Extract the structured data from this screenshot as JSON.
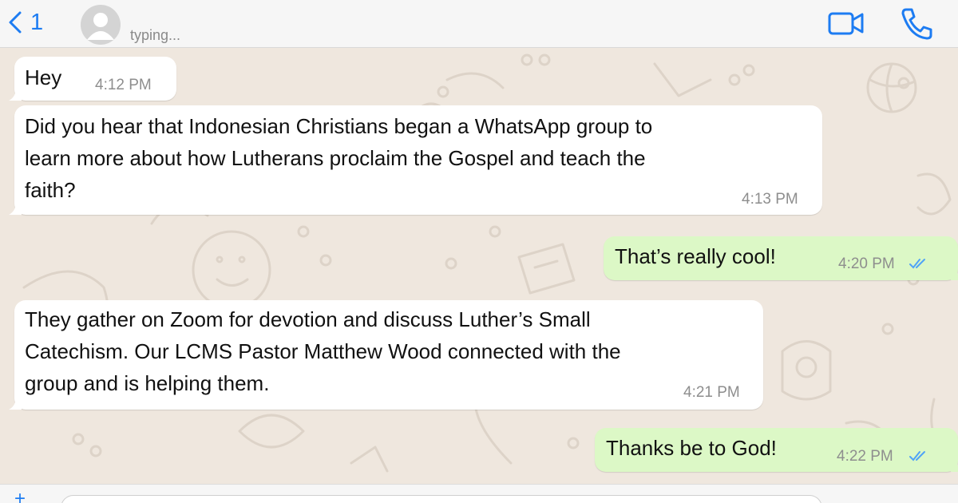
{
  "header": {
    "back_count": "1",
    "status": "typing...",
    "icons": [
      "chevron-left-icon",
      "avatar-placeholder-icon",
      "video-call-icon",
      "phone-call-icon"
    ]
  },
  "colors": {
    "accent": "#1d7cf2",
    "incoming_bubble": "#ffffff",
    "outgoing_bubble": "#dcf8c6",
    "wallpaper": "#efe7de",
    "read_ticks": "#4fa3f7"
  },
  "messages": [
    {
      "direction": "in",
      "lines": [
        "Hey"
      ],
      "time": "4:12 PM"
    },
    {
      "direction": "in",
      "lines": [
        "Did you hear that Indonesian Christians began a WhatsApp group to",
        "learn more about how Lutherans proclaim the Gospel and teach the",
        "faith?"
      ],
      "time": "4:13 PM"
    },
    {
      "direction": "out",
      "lines": [
        "That’s really cool!"
      ],
      "time": "4:20 PM",
      "read": true
    },
    {
      "direction": "in",
      "lines": [
        "They gather on Zoom for devotion and discuss Luther’s Small",
        "Catechism. Our LCMS Pastor Matthew Wood connected with the",
        "group and is helping them."
      ],
      "time": "4:21 PM"
    },
    {
      "direction": "out",
      "lines": [
        "Thanks be to God!"
      ],
      "time": "4:22 PM",
      "read": true
    }
  ]
}
